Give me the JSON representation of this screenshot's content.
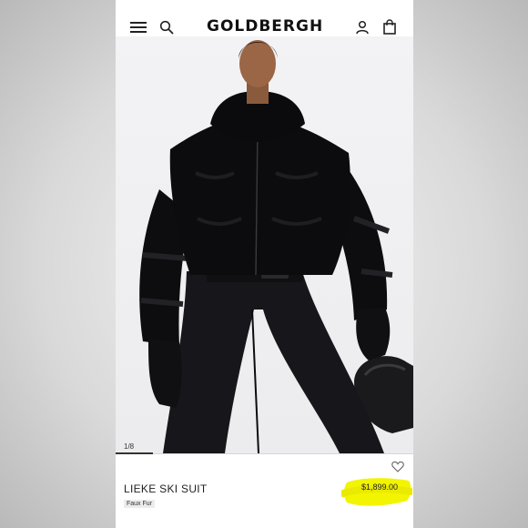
{
  "header": {
    "brand": "GOLDBERGH",
    "menu_icon": "hamburger-menu-icon",
    "search_icon": "search-icon",
    "account_icon": "user-account-icon",
    "bag_icon": "shopping-bag-icon"
  },
  "gallery": {
    "counter": "1/8",
    "current_image": 1,
    "total_images": 8
  },
  "product": {
    "name": "LIEKE SKI SUIT",
    "price": "$1,899.00",
    "tag": "Faux Fur",
    "wishlist_icon": "heart-icon"
  },
  "colors": {
    "highlight": "#f2f200",
    "text": "#222222",
    "background": "#ffffff"
  }
}
